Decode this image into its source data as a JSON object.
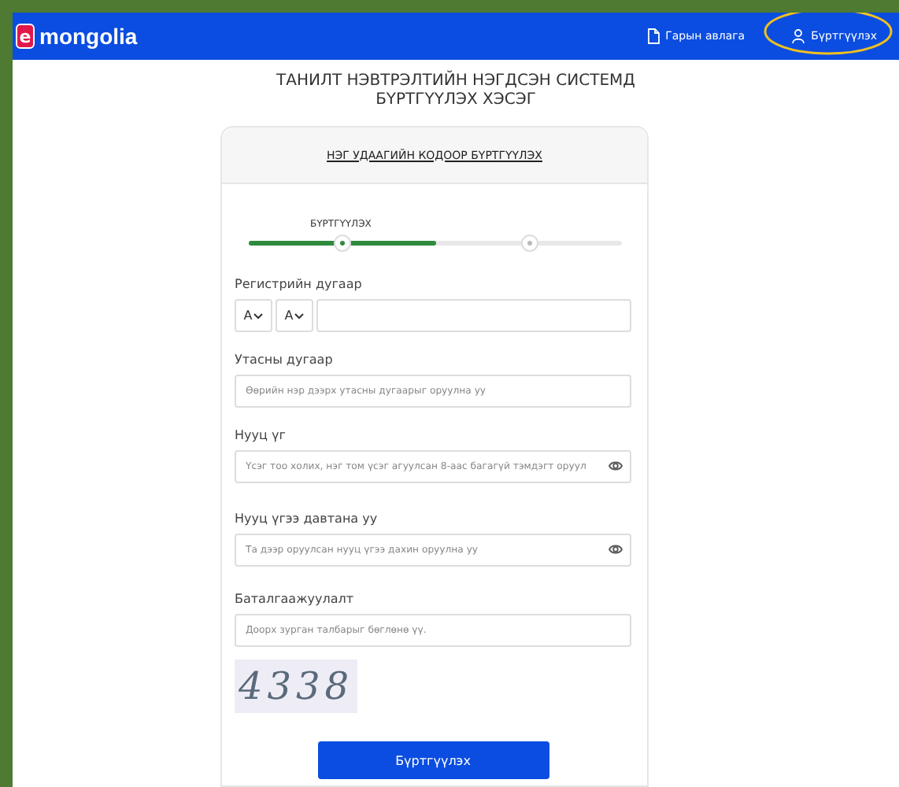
{
  "header": {
    "logo": {
      "mark": "e",
      "name": "mongolia"
    },
    "nav": [
      {
        "kind": "guide",
        "label": "Гарын авлага",
        "highlighted": false
      },
      {
        "kind": "user",
        "label": "Бүртгүүлэх",
        "highlighted": true
      }
    ]
  },
  "title": [
    "ТАНИЛТ НЭВТРЭЛТИЙН НЭГДСЭН СИСТЕМД",
    "БҮРТГҮҮЛЭХ ХЭСЭГ"
  ],
  "card": {
    "tab": "НЭГ УДААГИЙН КОДООР БҮРТГҮҮЛЭХ",
    "stepper": {
      "label": "БҮРТГҮҮЛЭХ",
      "level": 0.5
    },
    "fields": [
      {
        "kind": "register",
        "label": "Регистрийн дугаар",
        "selects": [
          "А",
          "А"
        ]
      },
      {
        "kind": "text",
        "label": "Утасны дугаар",
        "placeholder": "Өөрийн нэр дээрх утасны дугаарыг оруулна уу"
      },
      {
        "kind": "password",
        "label": "Нууц үг",
        "placeholder": "Үсэг тоо холих, нэг том үсэг агуулсан 8-аас багагүй тэмдэгт оруул"
      },
      {
        "kind": "password",
        "label": "Нууц үгээ давтана уу",
        "placeholder": "Та дээр оруулсан нууц үгээ дахин оруулна уу"
      },
      {
        "kind": "text",
        "label": "Баталгаажуулалт",
        "placeholder": "Доорх зурган талбарыг бөглөнө үү."
      }
    ],
    "captcha": "4338",
    "submit": "Бүртгүүлэх"
  }
}
